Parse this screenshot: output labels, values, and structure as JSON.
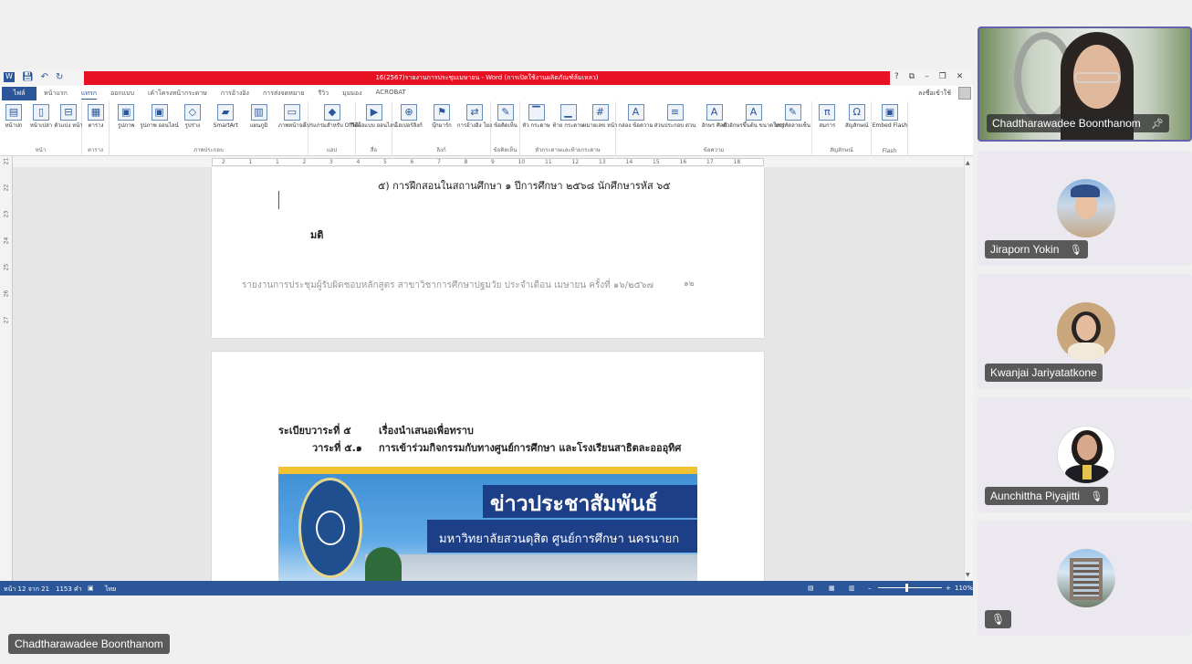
{
  "word": {
    "title": "16(2567)รายงานการประชุมเมษายน - Word (การเปิดใช้งานผลิตภัณฑ์ล้มเหลว)",
    "qat_icons": [
      "word-logo",
      "save",
      "undo",
      "redo"
    ],
    "window_controls": [
      "?",
      "⧉",
      "–",
      "❐",
      "✕"
    ],
    "file_tab": "ไฟล์",
    "tabs": [
      "หน้าแรก",
      "แทรก",
      "ออกแบบ",
      "เค้าโครงหน้ากระดาษ",
      "การอ้างอิง",
      "การส่งจดหมาย",
      "รีวิว",
      "มุมมอง",
      "ACROBAT"
    ],
    "active_tab": "แทรก",
    "signin": "ลงชื่อเข้าใช้",
    "ribbon_groups": [
      {
        "label": "หน้า",
        "buttons": [
          {
            "icon": "▤",
            "label": "หน้าปก"
          },
          {
            "icon": "▯",
            "label": "หน้าเปล่า"
          },
          {
            "icon": "⊟",
            "label": "ตัวแบ่ง หน้า"
          }
        ]
      },
      {
        "label": "ตาราง",
        "buttons": [
          {
            "icon": "▦",
            "label": "ตาราง"
          }
        ]
      },
      {
        "label": "ภาพประกอบ",
        "buttons": [
          {
            "icon": "▣",
            "label": "รูปภาพ"
          },
          {
            "icon": "▣",
            "label": "รูปภาพ ออนไลน์"
          },
          {
            "icon": "◇",
            "label": "รูปร่าง"
          },
          {
            "icon": "▰",
            "label": "SmartArt"
          },
          {
            "icon": "▥",
            "label": "แผนภูมิ"
          },
          {
            "icon": "▭",
            "label": "ภาพหน้าจอ"
          }
        ]
      },
      {
        "label": "แอป",
        "buttons": [
          {
            "icon": "◆",
            "label": "โปรแกรมสำหรับ Office"
          }
        ]
      },
      {
        "label": "สื่อ",
        "buttons": [
          {
            "icon": "▶",
            "label": "วิดีโอแบบ ออนไลน์"
          }
        ]
      },
      {
        "label": "ลิงก์",
        "buttons": [
          {
            "icon": "⊕",
            "label": "ไฮเปอร์ลิงก์"
          },
          {
            "icon": "⚑",
            "label": "บุ๊กมาร์ก"
          },
          {
            "icon": "⇄",
            "label": "การอ้างอิง โยง"
          }
        ]
      },
      {
        "label": "ข้อคิดเห็น",
        "buttons": [
          {
            "icon": "✎",
            "label": "ข้อคิดเห็น"
          }
        ]
      },
      {
        "label": "หัวกระดาษและท้ายกระดาษ",
        "buttons": [
          {
            "icon": "▔",
            "label": "หัว กระดาษ"
          },
          {
            "icon": "▁",
            "label": "ท้าย กระดาษ"
          },
          {
            "icon": "#",
            "label": "หมายเลข หน้า"
          }
        ]
      },
      {
        "label": "ข้อความ",
        "buttons": [
          {
            "icon": "A",
            "label": "กล่อง ข้อความ"
          },
          {
            "icon": "≡",
            "label": "ส่วนประกอบ ด่วน"
          },
          {
            "icon": "A",
            "label": "อักษร ศิลป์"
          },
          {
            "icon": "A",
            "label": "ตัวอักษรขึ้นต้น ขนาดใหญ่"
          },
          {
            "icon": "✎",
            "label": "บรรทัดลายเซ็น"
          }
        ]
      },
      {
        "label": "สัญลักษณ์",
        "buttons": [
          {
            "icon": "π",
            "label": "สมการ"
          },
          {
            "icon": "Ω",
            "label": "สัญลักษณ์"
          }
        ]
      },
      {
        "label": "Flash",
        "buttons": [
          {
            "icon": "▣",
            "label": "Embed Flash"
          }
        ]
      }
    ],
    "ruler_ticks": [
      "2",
      "1",
      "1",
      "2",
      "3",
      "4",
      "5",
      "6",
      "7",
      "8",
      "9",
      "10",
      "11",
      "12",
      "13",
      "14",
      "15",
      "16",
      "17",
      "18"
    ],
    "vruler_ticks": [
      "21",
      "22",
      "23",
      "24",
      "25",
      "26",
      "27"
    ],
    "doc": {
      "p1_line1": "๕) การฝึกสอนในสถานศึกษา ๑ ปีการศึกษา ๒๕๖๘ นักศึกษารหัส ๖๕",
      "p1_resolution": "มติ",
      "p1_footer": "รายงานการประชุมผู้รับผิดชอบหลักสูตร สาขาวิชาการศึกษาปฐมวัย ประจำเดือน เมษายน ครั้งที่ ๑๖/๒๕๖๗",
      "p1_pagenum": "๑๒",
      "p2_agenda_label": "ระเบียบวาระที่ ๕",
      "p2_agenda_text": "เรื่องนำเสนอเพื่อทราบ",
      "p2_item_label": "วาระที่ ๕.๑",
      "p2_item_text": "การเข้าร่วมกิจกรรมกับทางศูนย์การศึกษา และโรงเรียนสาธิตละอออุทิศ",
      "banner_title": "ข่าวประชาสัมพันธ์",
      "banner_sub": "มหาวิทยาลัยสวนดุสิต ศูนย์การศึกษา นครนายก"
    },
    "status": {
      "page": "หน้า 12 จาก 21",
      "words": "1153 คำ",
      "lang": "ไทย",
      "zoom": "110%"
    }
  },
  "participants": [
    {
      "name": "Chadtharawadee Boonthanom",
      "pinned": true,
      "muted": false,
      "video": true
    },
    {
      "name": "Jiraporn Yokin",
      "muted": true
    },
    {
      "name": "Kwanjai Jariyatatkone",
      "muted": false
    },
    {
      "name": "Aunchittha Piyajitti",
      "muted": true
    },
    {
      "name": "",
      "muted": true
    }
  ],
  "presenter_label": "Chadtharawadee Boonthanom",
  "colors": {
    "word_blue": "#2b579a",
    "title_red": "#e81123",
    "teams_purple": "#6264a7"
  }
}
